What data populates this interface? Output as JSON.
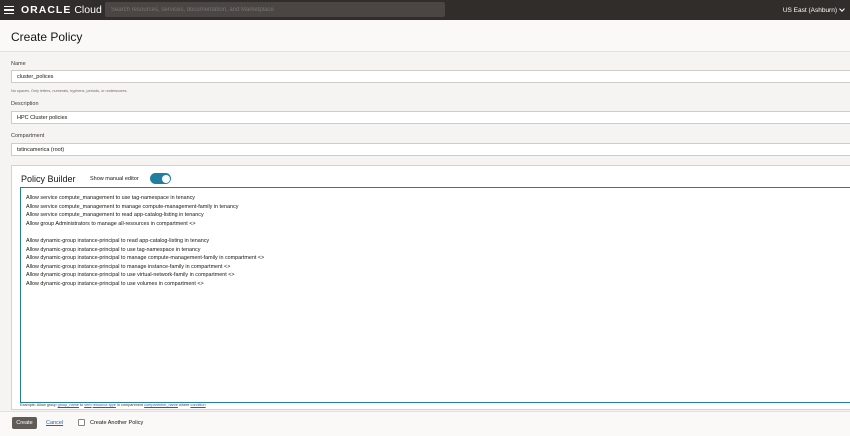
{
  "topbar": {
    "brand_oracle": "ORACLE",
    "brand_cloud": "Cloud",
    "search_placeholder": "Search resources, services, documentation, and Marketplace",
    "region": "US East (Ashburn)",
    "menu_icon": "hamburger-icon",
    "region_icon": "chevron-down-icon"
  },
  "page": {
    "title": "Create Policy"
  },
  "form": {
    "name_label": "Name",
    "name_value": "cluster_polices",
    "name_hint": "No spaces. Only letters, numerals, hyphens, periods, or underscores.",
    "description_label": "Description",
    "description_value": "HPC Cluster policies",
    "compartment_label": "Compartment",
    "compartment_value": "tstincamerica (root)"
  },
  "policy_builder": {
    "title": "Policy Builder",
    "manual_editor_label": "Show manual editor",
    "manual_editor_on": true,
    "lines": [
      "Allow service compute_management to use tag-namespace in tenancy",
      "Allow service compute_management to manage compute-management-family in tenancy",
      "Allow service compute_management to read app-catalog-listing in tenancy",
      "Allow group Administrators to manage all-resources in compartment <>",
      "",
      "Allow dynamic-group instance-principal to read app-catalog-listing in tenancy",
      "Allow dynamic-group instance-principal to use tag-namespace in tenancy",
      "Allow dynamic-group instance-principal to manage compute-management-family in compartment <>",
      "Allow dynamic-group instance-principal to manage instance-family in compartment <>",
      "Allow dynamic-group instance-principal to use virtual-network-family in compartment <>",
      "Allow dynamic-group instance-principal to use volumes in compartment <>"
    ],
    "example": {
      "prefix": "Example: Allow group",
      "group_name": "group_name",
      "to": "to",
      "verb": "verb",
      "resource_type": "resource-type",
      "in_compartment": "in compartment",
      "compartment_name": "compartment_name",
      "where": "where",
      "condition": "condition"
    }
  },
  "footer": {
    "create_label": "Create",
    "cancel_label": "Cancel",
    "create_another_label": "Create Another Policy",
    "accent_color": "#227e9e"
  }
}
